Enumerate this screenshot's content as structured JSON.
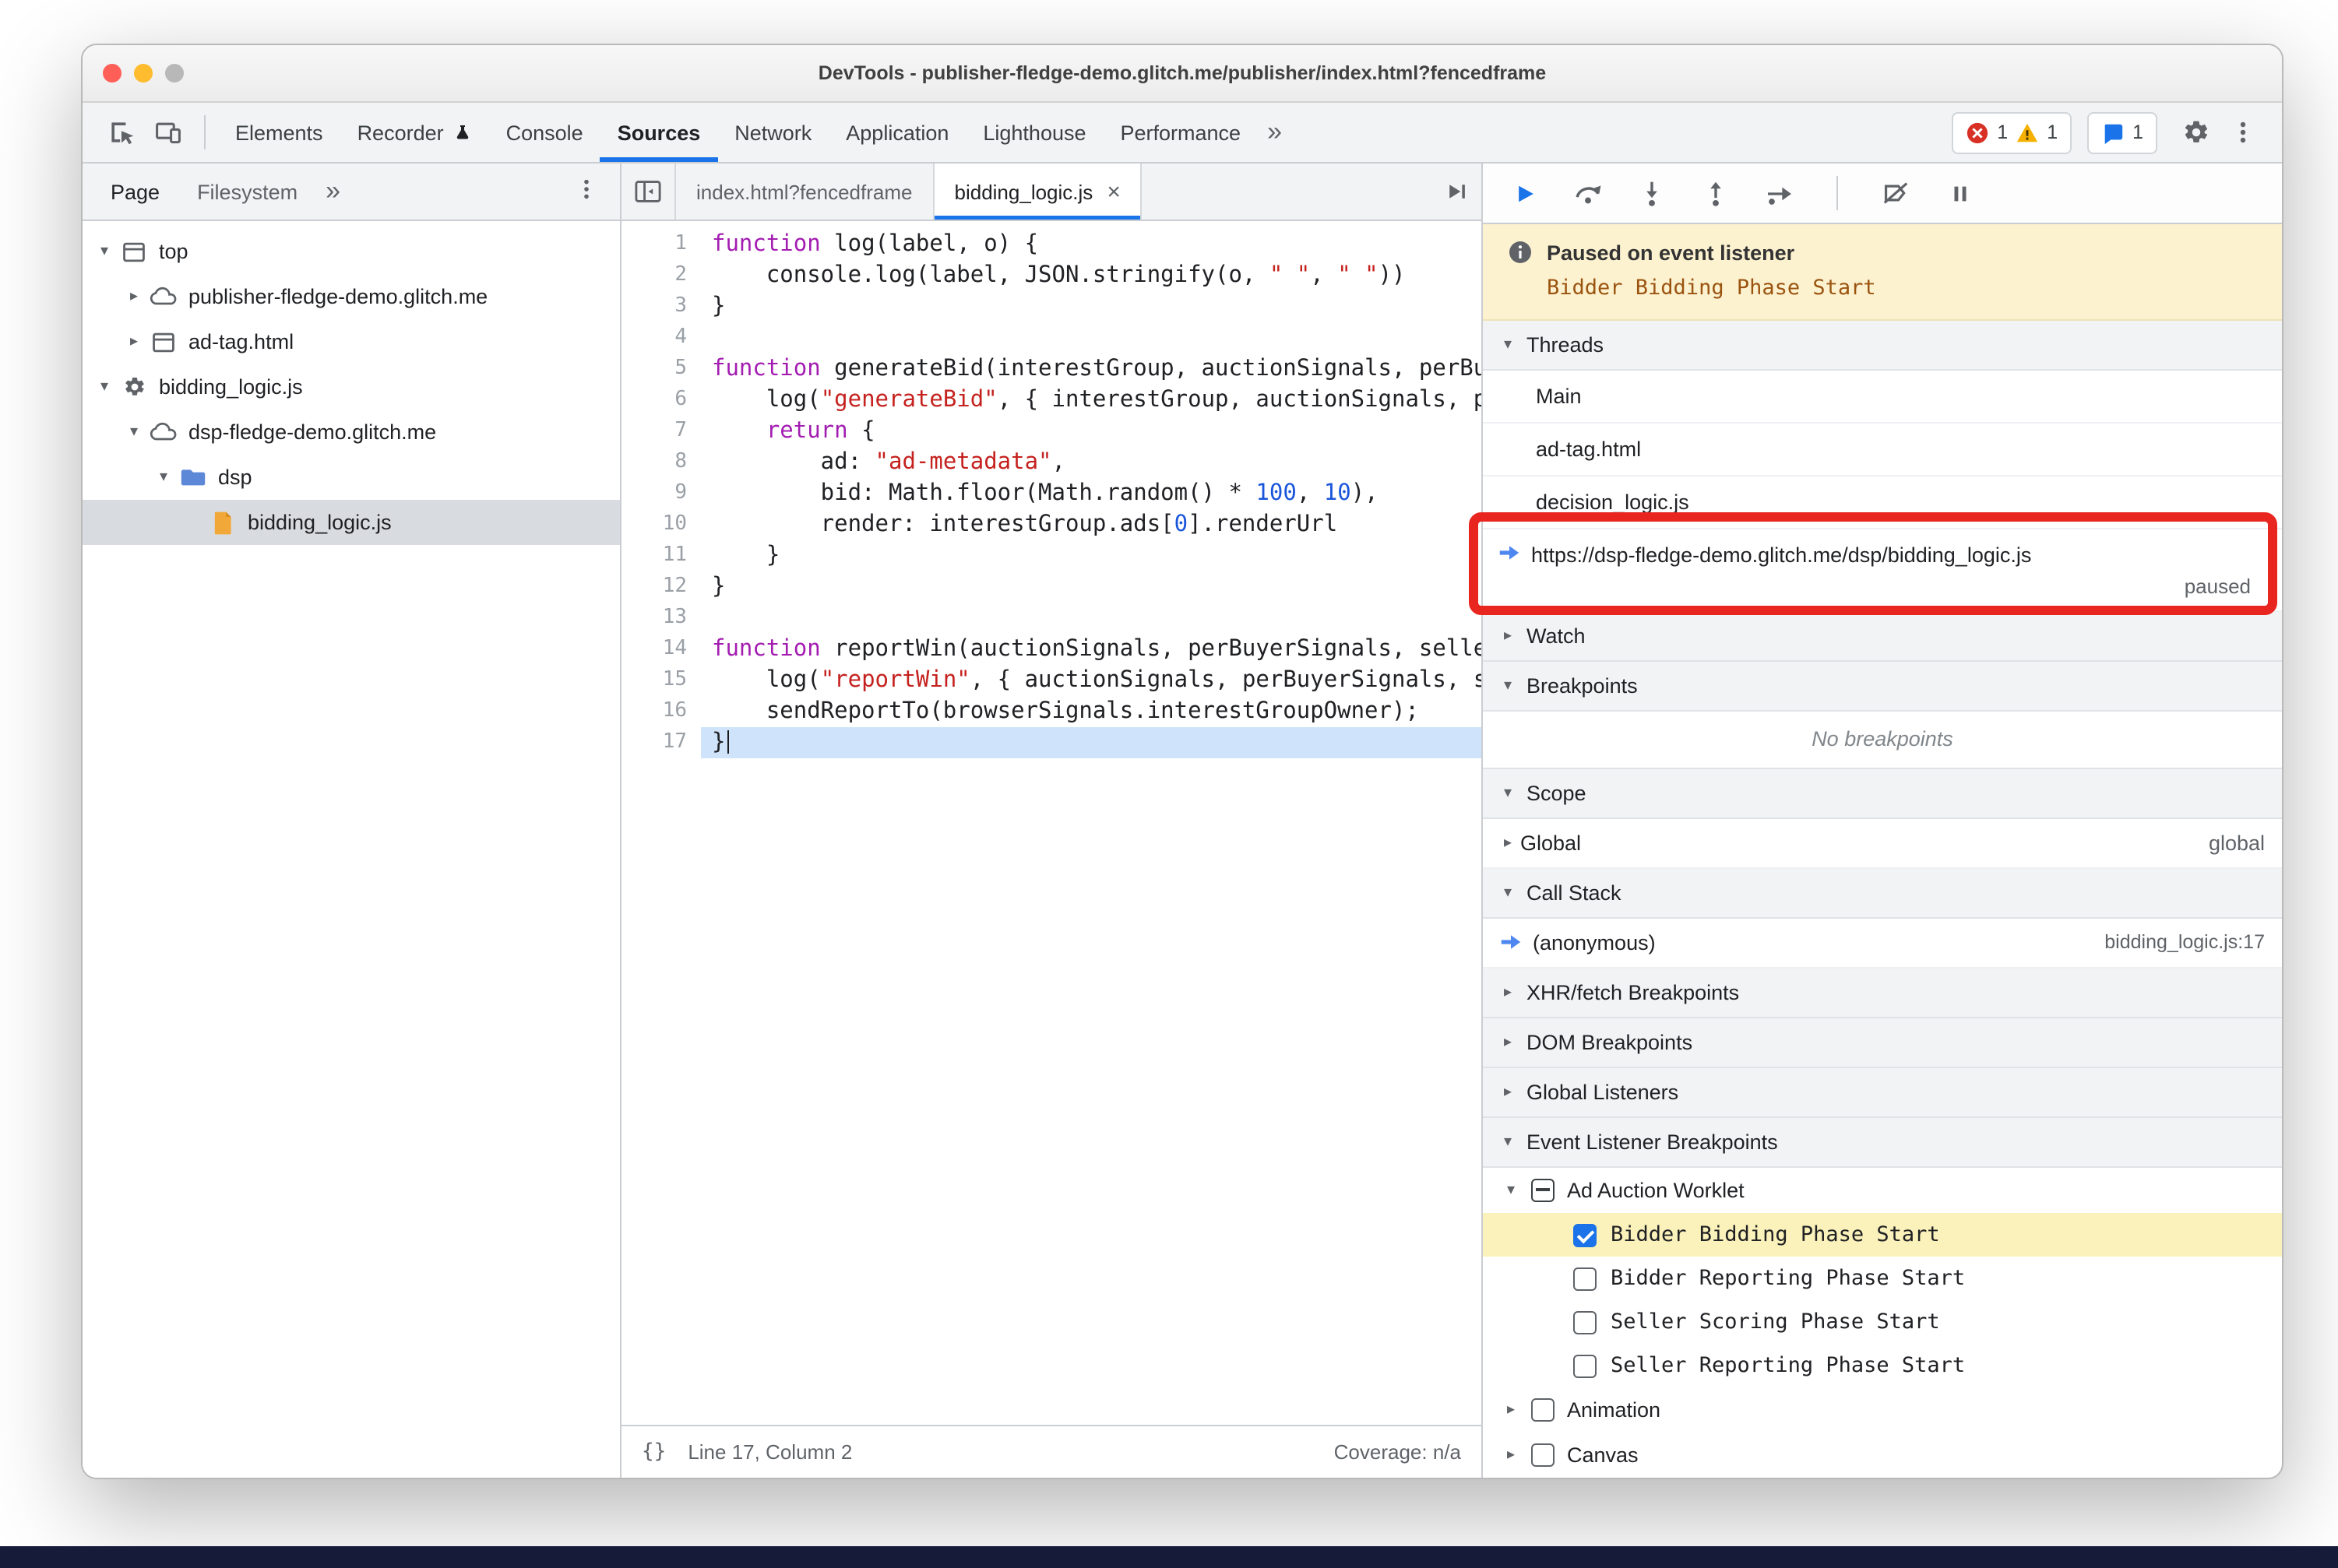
{
  "window": {
    "title": "DevTools - publisher-fledge-demo.glitch.me/publisher/index.html?fencedframe"
  },
  "toolbar": {
    "tabs": [
      "Elements",
      "Recorder",
      "Console",
      "Sources",
      "Network",
      "Application",
      "Lighthouse",
      "Performance"
    ],
    "active_tab": "Sources",
    "error_count": "1",
    "warning_count": "1",
    "issues_count": "1"
  },
  "sidebar": {
    "tabs": {
      "page": "Page",
      "filesystem": "Filesystem"
    },
    "tree": [
      {
        "label": "top",
        "icon": "frame",
        "arrow": "down",
        "level": 0
      },
      {
        "label": "publisher-fledge-demo.glitch.me",
        "icon": "cloud",
        "arrow": "right",
        "level": 1
      },
      {
        "label": "ad-tag.html",
        "icon": "frame",
        "arrow": "right",
        "level": 1
      },
      {
        "label": "bidding_logic.js",
        "icon": "gear",
        "arrow": "down",
        "level": 0
      },
      {
        "label": "dsp-fledge-demo.glitch.me",
        "icon": "cloud",
        "arrow": "down",
        "level": 1
      },
      {
        "label": "dsp",
        "icon": "folder",
        "arrow": "down",
        "level": 2
      },
      {
        "label": "bidding_logic.js",
        "icon": "file",
        "arrow": "none",
        "level": 3,
        "selected": true
      }
    ]
  },
  "editor": {
    "tabs": [
      {
        "label": "index.html?fencedframe",
        "active": false
      },
      {
        "label": "bidding_logic.js",
        "active": true
      }
    ],
    "status": {
      "line_col": "Line 17, Column 2",
      "coverage": "Coverage: n/a"
    },
    "lines": [
      {
        "n": 1,
        "t": [
          {
            "c": "k",
            "v": "function"
          },
          {
            "v": " log(label, o) {"
          }
        ]
      },
      {
        "n": 2,
        "t": [
          {
            "v": "    console.log(label, JSON.stringify(o, "
          },
          {
            "c": "s",
            "v": "\" \""
          },
          {
            "v": ", "
          },
          {
            "c": "s",
            "v": "\" \""
          },
          {
            "v": "))"
          }
        ]
      },
      {
        "n": 3,
        "t": [
          {
            "v": "}"
          }
        ]
      },
      {
        "n": 4,
        "t": []
      },
      {
        "n": 5,
        "t": [
          {
            "c": "k",
            "v": "function"
          },
          {
            "v": " generateBid(interestGroup, auctionSignals, perBuyerSignals, trustedBiddingSignals, browserSignals) {"
          }
        ]
      },
      {
        "n": 6,
        "t": [
          {
            "v": "    log("
          },
          {
            "c": "s",
            "v": "\"generateBid\""
          },
          {
            "v": ", { interestGroup, auctionSignals, perBuyerSignals, trustedBiddingSignals, browserSignals });"
          }
        ]
      },
      {
        "n": 7,
        "t": [
          {
            "v": "    "
          },
          {
            "c": "k",
            "v": "return"
          },
          {
            "v": " {"
          }
        ]
      },
      {
        "n": 8,
        "t": [
          {
            "v": "        ad: "
          },
          {
            "c": "s",
            "v": "\"ad-metadata\""
          },
          {
            "v": ","
          }
        ]
      },
      {
        "n": 9,
        "t": [
          {
            "v": "        bid: Math.floor(Math.random() * "
          },
          {
            "c": "n",
            "v": "100"
          },
          {
            "v": ", "
          },
          {
            "c": "n",
            "v": "10"
          },
          {
            "v": "),"
          }
        ]
      },
      {
        "n": 10,
        "t": [
          {
            "v": "        render: interestGroup.ads["
          },
          {
            "c": "n",
            "v": "0"
          },
          {
            "v": "].renderUrl"
          }
        ]
      },
      {
        "n": 11,
        "t": [
          {
            "v": "    }"
          }
        ]
      },
      {
        "n": 12,
        "t": [
          {
            "v": "}"
          }
        ]
      },
      {
        "n": 13,
        "t": []
      },
      {
        "n": 14,
        "t": [
          {
            "c": "k",
            "v": "function"
          },
          {
            "v": " reportWin(auctionSignals, perBuyerSignals, sellerSignals, browserSignals) {"
          }
        ]
      },
      {
        "n": 15,
        "t": [
          {
            "v": "    log("
          },
          {
            "c": "s",
            "v": "\"reportWin\""
          },
          {
            "v": ", { auctionSignals, perBuyerSignals, sellerSignals, browserSignals });"
          }
        ]
      },
      {
        "n": 16,
        "t": [
          {
            "v": "    sendReportTo(browserSignals.interestGroupOwner);"
          }
        ]
      },
      {
        "n": 17,
        "t": [
          {
            "v": "}"
          }
        ],
        "exec": true
      }
    ]
  },
  "debugger": {
    "paused": {
      "title": "Paused on event listener",
      "reason": "Bidder Bidding Phase Start"
    },
    "threads": {
      "title": "Threads",
      "items": [
        {
          "label": "Main"
        },
        {
          "label": "ad-tag.html"
        },
        {
          "label": "decision_logic.js"
        },
        {
          "label": "https://dsp-fledge-demo.glitch.me/dsp/bidding_logic.js",
          "active": true,
          "status": "paused"
        }
      ]
    },
    "watch": {
      "title": "Watch"
    },
    "breakpoints": {
      "title": "Breakpoints",
      "empty_message": "No breakpoints"
    },
    "scope": {
      "title": "Scope",
      "rows": [
        {
          "label": "Global",
          "value": "global"
        }
      ]
    },
    "call_stack": {
      "title": "Call Stack",
      "frames": [
        {
          "label": "(anonymous)",
          "location": "bidding_logic.js:17"
        }
      ]
    },
    "xhr_breakpoints": {
      "title": "XHR/fetch Breakpoints"
    },
    "dom_breakpoints": {
      "title": "DOM Breakpoints"
    },
    "global_listeners": {
      "title": "Global Listeners"
    },
    "event_listener_breakpoints": {
      "title": "Event Listener Breakpoints",
      "groups": [
        {
          "label": "Ad Auction Worklet",
          "checkbox": "indeterminate",
          "expanded": true,
          "children": [
            {
              "label": "Bidder Bidding Phase Start",
              "checked": true,
              "highlighted": true
            },
            {
              "label": "Bidder Reporting Phase Start",
              "checked": false
            },
            {
              "label": "Seller Scoring Phase Start",
              "checked": false
            },
            {
              "label": "Seller Reporting Phase Start",
              "checked": false
            }
          ]
        },
        {
          "label": "Animation",
          "checkbox": "unchecked",
          "expanded": false,
          "children": []
        },
        {
          "label": "Canvas",
          "checkbox": "unchecked",
          "expanded": false,
          "children": []
        }
      ]
    }
  },
  "colors": {
    "accent": "#1a73e8",
    "error": "#d93025",
    "warning": "#f6b100",
    "annotation_red": "#e8261f",
    "paused_banner_bg": "#fdf2d0",
    "exec_line_bg": "#cfe4fa",
    "highlight_row_bg": "#fbf1ba"
  }
}
